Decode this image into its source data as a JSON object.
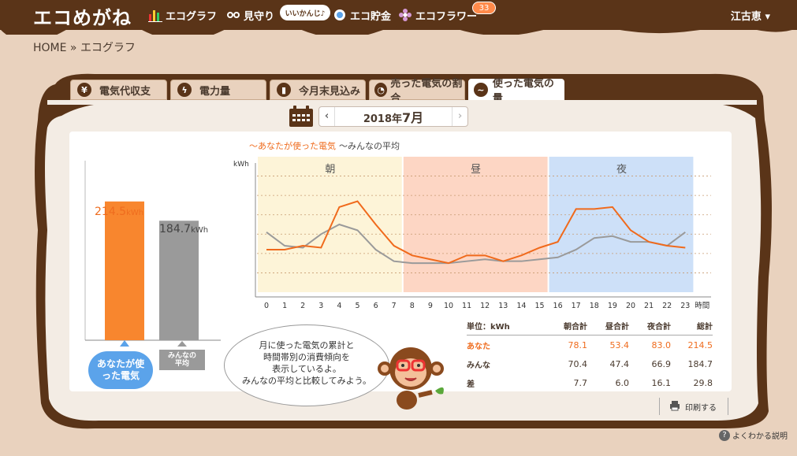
{
  "app": {
    "logo": "エコめがね",
    "user_name": "江古恵"
  },
  "nav": {
    "items": [
      {
        "label": "エコグラフ",
        "icon": "bar-graph-icon"
      },
      {
        "label": "見守り",
        "icon": "binoculars-icon"
      },
      {
        "label": "エコ貯金",
        "icon": "coin-icon"
      },
      {
        "label": "エコフラワー",
        "icon": "flower-icon"
      }
    ],
    "bubble": "いいかんじ♪",
    "flower_count": "33"
  },
  "breadcrumb": {
    "text": "HOME » エコグラフ"
  },
  "tabs": [
    {
      "label": "電気代収支",
      "icon": "yen-icon"
    },
    {
      "label": "電力量",
      "icon": "bolt-icon"
    },
    {
      "label": "今月末見込み",
      "icon": "forecast-icon"
    },
    {
      "label": "売った電気の割合",
      "icon": "pie-icon"
    },
    {
      "label": "使った電気の量",
      "icon": "wave-icon",
      "active": true
    }
  ],
  "month": {
    "year": "2018年",
    "month": "7月"
  },
  "legend": {
    "me": "〜あなたが使った電気",
    "avg": "〜みんなの平均"
  },
  "colors": {
    "me": "#ef6c1e",
    "avg": "#999999",
    "morning": "#fdf4d8",
    "noon": "#fdd6c4",
    "night": "#cde0f8"
  },
  "summary": {
    "me_value": "214.5",
    "avg_value": "184.7",
    "unit": "kWh",
    "me_label": "あなたが使った電気",
    "avg_label_1": "みんなの",
    "avg_label_2": "平均"
  },
  "speech": {
    "line1": "月に使った電気の累計と",
    "line2": "時間帯別の消費傾向を",
    "line3": "表示しているよ。",
    "line4": "みんなの平均と比較してみよう。"
  },
  "table": {
    "headers": [
      "単位：kWh",
      "朝合計",
      "昼合計",
      "夜合計",
      "総計"
    ],
    "rows": [
      {
        "label": "あなた",
        "values": [
          "78.1",
          "53.4",
          "83.0",
          "214.5"
        ]
      },
      {
        "label": "みんな",
        "values": [
          "70.4",
          "47.4",
          "66.9",
          "184.7"
        ]
      },
      {
        "label": "差",
        "values": [
          "7.7",
          "6.0",
          "16.1",
          "29.8"
        ]
      }
    ]
  },
  "footer": {
    "print": "印刷する",
    "help": "よくわかる説明"
  },
  "chart_data": [
    {
      "type": "bar",
      "categories": [
        "あなたが使った電気",
        "みんなの平均"
      ],
      "values": [
        214.5,
        184.7
      ],
      "ylabel": "kWh"
    },
    {
      "type": "line",
      "ylabel": "kWh",
      "xlabel": "時間",
      "x": [
        0,
        1,
        2,
        3,
        4,
        5,
        6,
        7,
        8,
        9,
        10,
        11,
        12,
        13,
        14,
        15,
        16,
        17,
        18,
        19,
        20,
        21,
        22,
        23
      ],
      "bands": [
        {
          "label": "朝",
          "from": 0,
          "to": 7
        },
        {
          "label": "昼",
          "from": 8,
          "to": 15
        },
        {
          "label": "夜",
          "from": 16,
          "to": 23
        }
      ],
      "ylim": [
        0,
        7
      ],
      "series": [
        {
          "name": "あなたが使った電気",
          "values": [
            2.2,
            2.2,
            2.4,
            2.3,
            4.4,
            4.7,
            3.5,
            2.4,
            1.9,
            1.7,
            1.5,
            1.9,
            1.9,
            1.6,
            1.9,
            2.3,
            2.6,
            4.3,
            4.3,
            4.4,
            3.2,
            2.6,
            2.4,
            2.3
          ]
        },
        {
          "name": "みんなの平均",
          "values": [
            3.1,
            2.4,
            2.3,
            3.0,
            3.5,
            3.2,
            2.2,
            1.6,
            1.5,
            1.5,
            1.5,
            1.6,
            1.7,
            1.6,
            1.6,
            1.7,
            1.8,
            2.2,
            2.8,
            2.9,
            2.6,
            2.6,
            2.4,
            3.1
          ]
        }
      ]
    }
  ]
}
